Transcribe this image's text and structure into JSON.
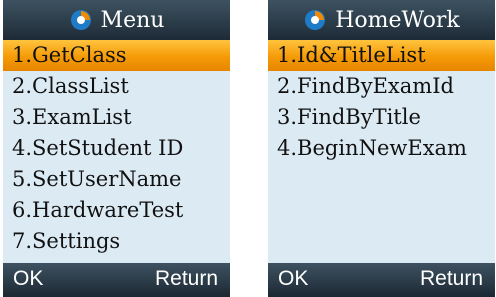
{
  "colors": {
    "bar_dark": "#1d2b36",
    "list_background": "#dceaf4",
    "selection_orange": "#f59a07",
    "icon_blue": "#1e7bc8",
    "icon_orange": "#f08a00"
  },
  "menu_screen": {
    "title": "Menu",
    "icon": "app-logo-icon",
    "items": [
      {
        "label": "1.GetClass",
        "selected": true
      },
      {
        "label": "2.ClassList",
        "selected": false
      },
      {
        "label": "3.ExamList",
        "selected": false
      },
      {
        "label": "4.SetStudent ID",
        "selected": false
      },
      {
        "label": "5.SetUserName",
        "selected": false
      },
      {
        "label": "6.HardwareTest",
        "selected": false
      },
      {
        "label": "7.Settings",
        "selected": false
      }
    ],
    "soft_left": "OK",
    "soft_right": "Return"
  },
  "homework_screen": {
    "title": "HomeWork",
    "icon": "app-logo-icon",
    "items": [
      {
        "label": "1.Id&TitleList",
        "selected": true
      },
      {
        "label": "2.FindByExamId",
        "selected": false
      },
      {
        "label": "3.FindByTitle",
        "selected": false
      },
      {
        "label": "4.BeginNewExam",
        "selected": false
      }
    ],
    "soft_left": "OK",
    "soft_right": "Return"
  }
}
